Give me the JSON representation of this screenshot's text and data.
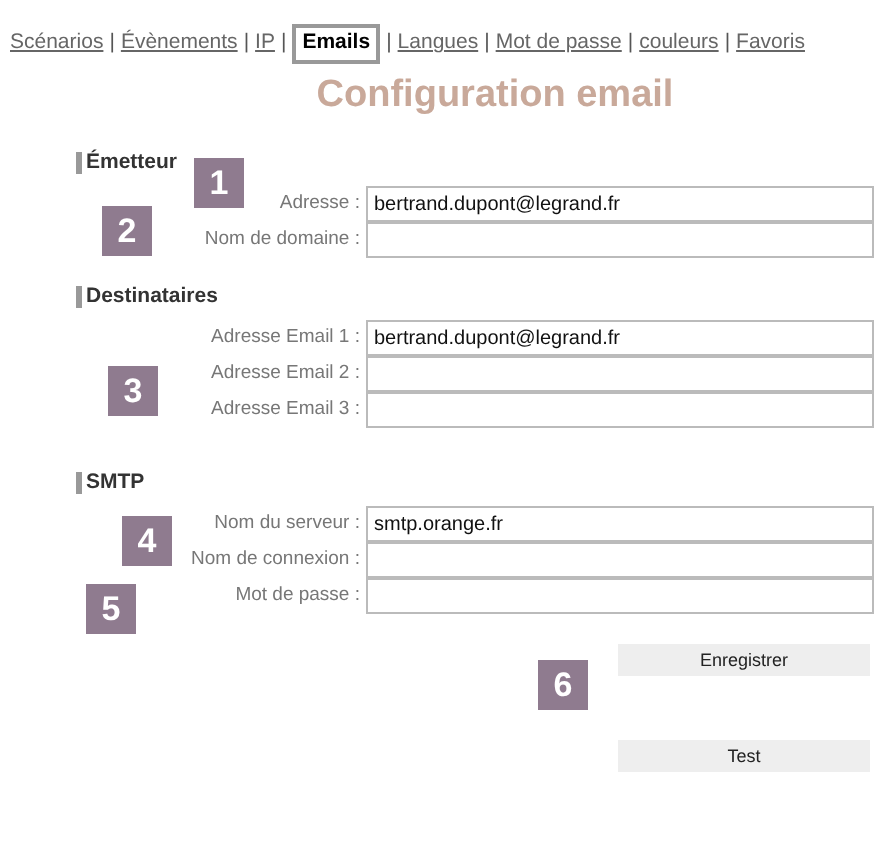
{
  "nav": [
    {
      "label": "Scénarios",
      "selected": false
    },
    {
      "label": "Évènements",
      "selected": false
    },
    {
      "label": "IP",
      "selected": false
    },
    {
      "label": "Emails",
      "selected": true
    },
    {
      "label": "Langues",
      "selected": false
    },
    {
      "label": "Mot de passe",
      "selected": false
    },
    {
      "label": "couleurs",
      "selected": false
    },
    {
      "label": "Favoris",
      "selected": false
    }
  ],
  "separator": "|",
  "title": "Configuration email",
  "sections": [
    {
      "heading": "Émetteur",
      "fields": [
        {
          "label": "Adresse :",
          "value": "bertrand.dupont@legrand.fr"
        },
        {
          "label": "Nom de domaine :"
        }
      ]
    },
    {
      "heading": "Destinataires",
      "fields": [
        {
          "label": "Adresse Email 1 :",
          "value": "bertrand.dupont@legrand.fr"
        },
        {
          "label": "Adresse Email 2 :"
        },
        {
          "label": "Adresse Email 3 :"
        }
      ]
    },
    {
      "heading": "SMTP",
      "fields": [
        {
          "label": "Nom du serveur :",
          "value": "smtp.orange.fr"
        },
        {
          "label": "Nom de connexion :"
        },
        {
          "label": "Mot de passe :"
        }
      ]
    }
  ],
  "buttons": [
    "Enregistrer",
    "Test"
  ],
  "markers": [
    "1",
    "2",
    "3",
    "4",
    "5",
    "6"
  ]
}
